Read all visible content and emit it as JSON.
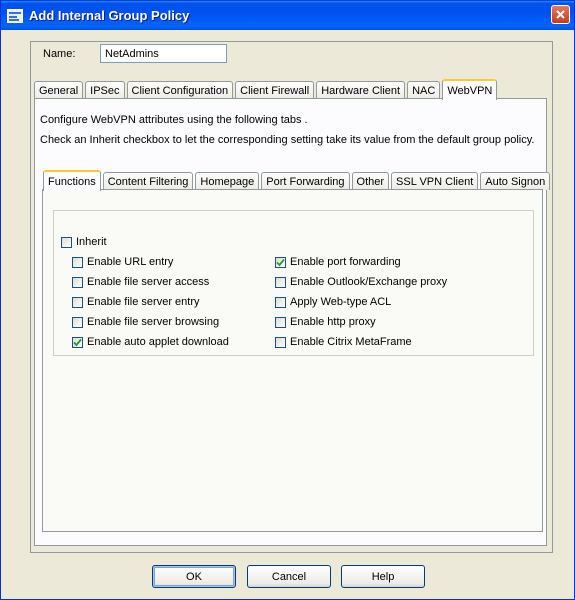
{
  "window": {
    "title": "Add Internal Group Policy",
    "icon": "policy-icon",
    "close_icon": "close-icon"
  },
  "name_field": {
    "label": "Name:",
    "value": "NetAdmins"
  },
  "main_tabs": [
    {
      "label": "General",
      "active": false
    },
    {
      "label": "IPSec",
      "active": false
    },
    {
      "label": "Client Configuration",
      "active": false
    },
    {
      "label": "Client Firewall",
      "active": false
    },
    {
      "label": "Hardware Client",
      "active": false
    },
    {
      "label": "NAC",
      "active": false
    },
    {
      "label": "WebVPN",
      "active": true
    }
  ],
  "webvpn": {
    "description1": "Configure WebVPN attributes using the following tabs .",
    "description2": "Check an Inherit checkbox to let the corresponding setting take its value from the default group policy.",
    "sub_tabs": [
      {
        "label": "Functions",
        "active": true
      },
      {
        "label": "Content Filtering",
        "active": false
      },
      {
        "label": "Homepage",
        "active": false
      },
      {
        "label": "Port Forwarding",
        "active": false
      },
      {
        "label": "Other",
        "active": false
      },
      {
        "label": "SSL VPN Client",
        "active": false
      },
      {
        "label": "Auto Signon",
        "active": false
      }
    ],
    "functions": {
      "inherit": {
        "label": "Inherit",
        "checked": false
      },
      "left_options": [
        {
          "label": "Enable URL entry",
          "checked": false
        },
        {
          "label": "Enable file server access",
          "checked": false
        },
        {
          "label": "Enable file server entry",
          "checked": false
        },
        {
          "label": "Enable file server browsing",
          "checked": false
        },
        {
          "label": "Enable auto applet download",
          "checked": true
        }
      ],
      "right_options": [
        {
          "label": "Enable port forwarding",
          "checked": true
        },
        {
          "label": "Enable Outlook/Exchange proxy",
          "checked": false
        },
        {
          "label": "Apply Web-type ACL",
          "checked": false
        },
        {
          "label": "Enable http proxy",
          "checked": false
        },
        {
          "label": "Enable Citrix MetaFrame",
          "checked": false
        }
      ]
    }
  },
  "buttons": {
    "ok": "OK",
    "cancel": "Cancel",
    "help": "Help"
  },
  "colors": {
    "titlebar": "#0053ee",
    "checkmark": "#21a121",
    "active_tab_accent": "#ffc83c"
  }
}
